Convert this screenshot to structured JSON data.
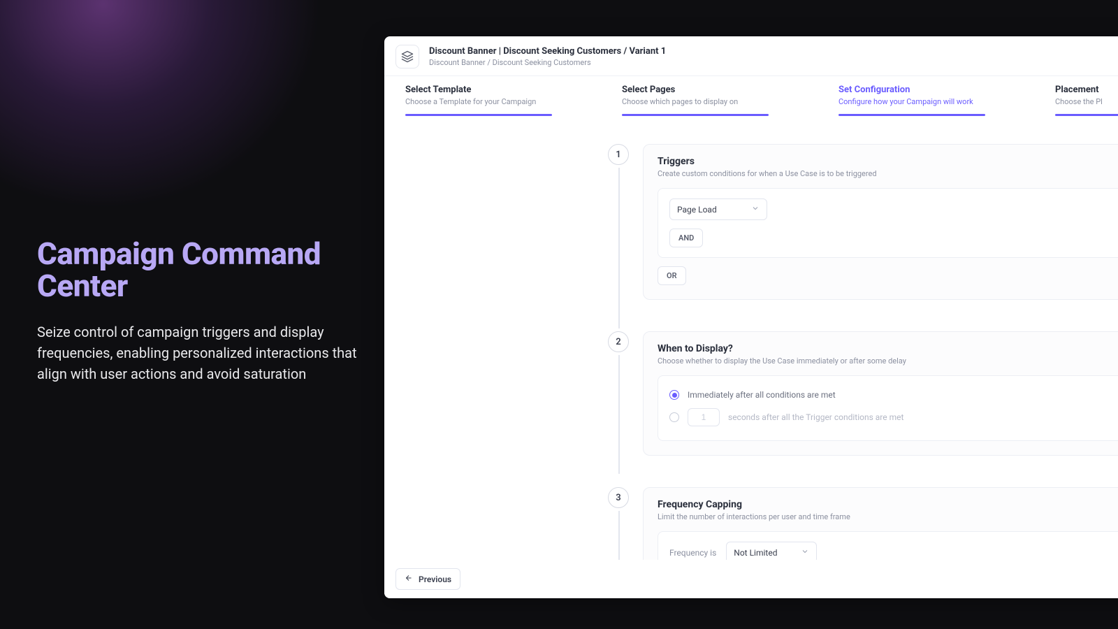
{
  "marketing": {
    "headline": "Campaign Command Center",
    "subcopy": "Seize control of campaign triggers and display frequencies, enabling personalized interactions that align with user actions and avoid saturation"
  },
  "header": {
    "title": "Discount Banner | Discount Seeking Customers / Variant 1",
    "breadcrumb": "Discount Banner / Discount Seeking Customers"
  },
  "stepper": [
    {
      "title": "Select Template",
      "sub": "Choose a Template for your Campaign",
      "active": false
    },
    {
      "title": "Select Pages",
      "sub": "Choose which pages to display on",
      "active": false
    },
    {
      "title": "Set Configuration",
      "sub": "Configure how your Campaign will work",
      "active": true
    },
    {
      "title": "Placement",
      "sub": "Choose the Pl",
      "active": false
    }
  ],
  "sections": {
    "triggers": {
      "num": "1",
      "title": "Triggers",
      "sub": "Create custom conditions for when a Use Case is to be triggered",
      "select_value": "Page Load",
      "and_label": "AND",
      "or_label": "OR"
    },
    "when": {
      "num": "2",
      "title": "When to Display?",
      "sub": "Choose whether to display the Use Case immediately or after some delay",
      "opt_immediate": "Immediately after all conditions are met",
      "opt_delay_value": "1",
      "opt_delay_suffix": "seconds after all the Trigger conditions are met"
    },
    "freq": {
      "num": "3",
      "title": "Frequency Capping",
      "sub": "Limit the number of interactions per user and time frame",
      "label": "Frequency is",
      "select_value": "Not Limited"
    }
  },
  "footer": {
    "previous": "Previous"
  }
}
